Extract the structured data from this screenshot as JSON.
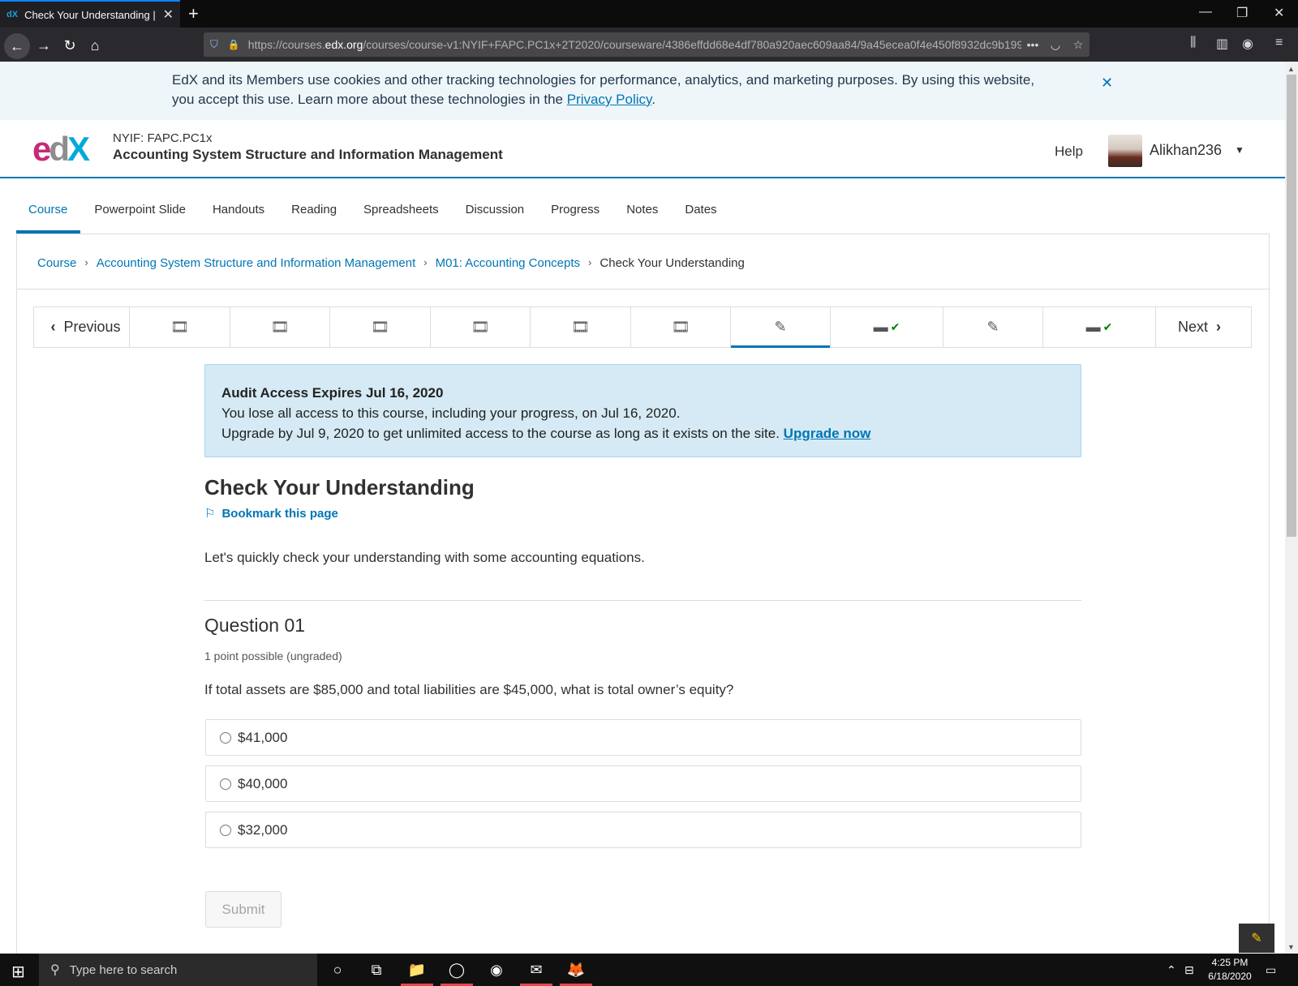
{
  "browser": {
    "tab_title": "Check Your Understanding | M",
    "tab_favicon": "dX",
    "url_prefix": "https://courses.",
    "url_domain": "edx.org",
    "url_rest": "/courses/course-v1:NYIF+FAPC.PC1x+2T2020/courseware/4386effdd68e4df780a920aec609aa84/9a45ecea0f4e450f8932dc9b199"
  },
  "cookie_banner": {
    "text": "EdX and its Members use cookies and other tracking technologies for performance, analytics, and marketing purposes. By using this website, you accept this use. Learn more about these technologies in the ",
    "link": "Privacy Policy",
    "after": "."
  },
  "header": {
    "course_org": "NYIF: FAPC.PC1x",
    "course_title": "Accounting System Structure and Information Management",
    "help": "Help",
    "username": "Alikhan236"
  },
  "course_nav": [
    "Course",
    "Powerpoint Slide",
    "Handouts",
    "Reading",
    "Spreadsheets",
    "Discussion",
    "Progress",
    "Notes",
    "Dates"
  ],
  "breadcrumbs": {
    "items": [
      "Course",
      "Accounting System Structure and Information Management",
      "M01: Accounting Concepts"
    ],
    "current": "Check Your Understanding"
  },
  "sequence": {
    "previous": "Previous",
    "next": "Next",
    "items": [
      "video-icon",
      "video-icon",
      "video-icon",
      "video-icon",
      "video-icon",
      "video-icon",
      "problem-icon",
      "book-check-icon",
      "problem-icon",
      "book-check-icon"
    ]
  },
  "audit_banner": {
    "title": "Audit Access Expires Jul 16, 2020",
    "line1": "You lose all access to this course, including your progress, on Jul 16, 2020.",
    "line2": "Upgrade by Jul 9, 2020 to get unlimited access to the course as long as it exists on the site. ",
    "link": "Upgrade now"
  },
  "unit": {
    "title": "Check Your Understanding",
    "bookmark": "Bookmark this page",
    "intro": "Let's quickly check your understanding with some accounting equations."
  },
  "question": {
    "title": "Question 01",
    "points": "1 point possible (ungraded)",
    "text": "If total assets are $85,000 and total liabilities are $45,000, what is total owner’s equity?",
    "options": [
      "$41,000",
      "$40,000",
      "$32,000"
    ],
    "submit": "Submit"
  },
  "taskbar": {
    "search_placeholder": "Type here to search",
    "time": "4:25 PM",
    "date": "6/18/2020"
  },
  "colors": {
    "accent": "#0075b4",
    "success": "#008100"
  }
}
